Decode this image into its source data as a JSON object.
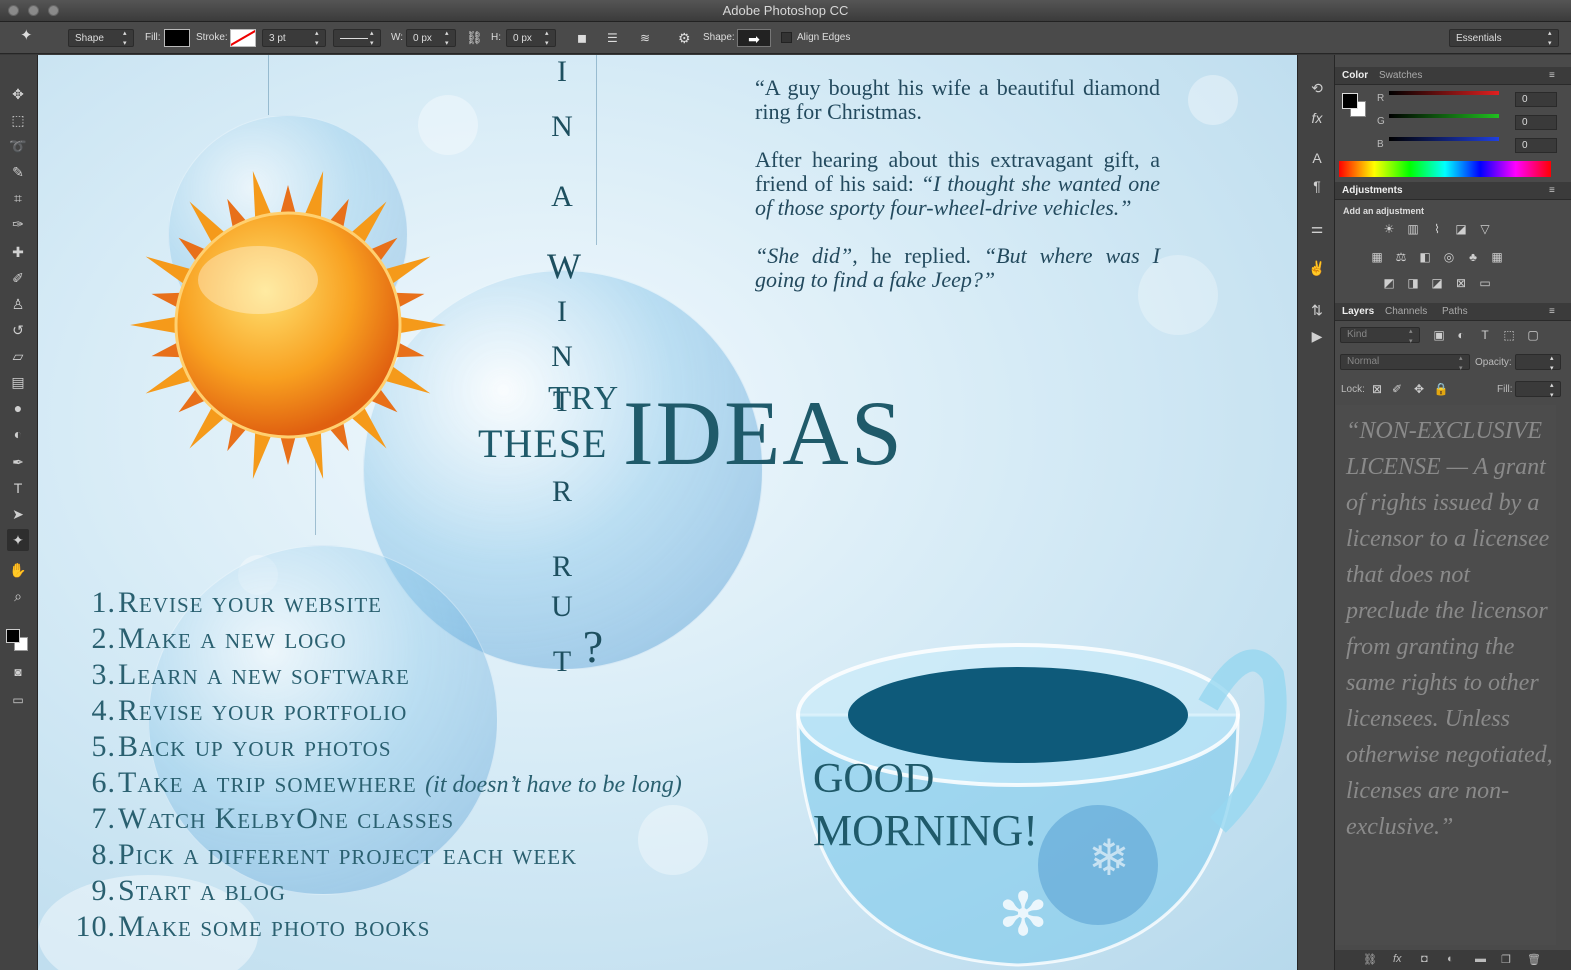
{
  "app": {
    "title": "Adobe Photoshop CC"
  },
  "options_bar": {
    "mode": "Shape",
    "fill_label": "Fill:",
    "stroke_label": "Stroke:",
    "stroke_size": "3 pt",
    "w_label": "W:",
    "w_value": "0 px",
    "h_label": "H:",
    "h_value": "0 px",
    "shape_label": "Shape:",
    "align_edges": "Align Edges",
    "workspace": "Essentials"
  },
  "color_panel": {
    "tabs": [
      "Color",
      "Swatches"
    ],
    "r_label": "R",
    "g_label": "G",
    "b_label": "B",
    "r": "0",
    "g": "0",
    "b": "0"
  },
  "adjustments_panel": {
    "title": "Adjustments",
    "subtitle": "Add an adjustment"
  },
  "layers_panel": {
    "tabs": [
      "Layers",
      "Channels",
      "Paths"
    ],
    "kind": "Kind",
    "blend_mode": "Normal",
    "opacity_label": "Opacity:",
    "lock_label": "Lock:",
    "fill_label": "Fill:"
  },
  "canvas": {
    "joke": {
      "p1": "“A guy bought his wife a beautiful diamond ring for Christmas.",
      "p2a": "After hearing about this extravagant gift, a friend of his said: ",
      "p2b": "“I thought she wanted one of those sporty four-wheel-drive vehicles.”",
      "p3a": "“She did”",
      "p3b": ", he replied. ",
      "p3c": "“But where was I going to find a fake Jeep?”"
    },
    "vertical_letters": [
      "I",
      "N",
      "A",
      "W",
      "I",
      "N",
      "T",
      "R",
      "R",
      "U",
      "T",
      "?"
    ],
    "try": "TRY",
    "these": "THESE",
    "ideas": "IDEAS",
    "good": "GOOD",
    "morning": "MORNING!",
    "ideas_list": [
      {
        "num": "1.",
        "text": "Revise your website",
        "aside": ""
      },
      {
        "num": "2.",
        "text": "Make a new logo",
        "aside": ""
      },
      {
        "num": "3.",
        "text": "Learn a new software",
        "aside": ""
      },
      {
        "num": "4.",
        "text": "Revise your portfolio",
        "aside": ""
      },
      {
        "num": "5.",
        "text": "Back up your photos",
        "aside": ""
      },
      {
        "num": "6.",
        "text": "Take a trip somewhere",
        "aside": "(it doesn’t have to be long)"
      },
      {
        "num": "7.",
        "text": "Watch KelbyOne classes",
        "aside": ""
      },
      {
        "num": "8.",
        "text": "Pick a different project each week",
        "aside": ""
      },
      {
        "num": "9.",
        "text": "Start a blog",
        "aside": ""
      },
      {
        "num": "10.",
        "text": "Make some photo books",
        "aside": ""
      }
    ]
  },
  "license_text": "“NON-EXCLUSIVE LICENSE — A grant of rights issued by a licensor to a licensee that does not preclude the licensor from granting the same rights to other licensees. Unless otherwise negotiated, licenses are non-exclusive.”",
  "colors": {
    "accent_text": "#2a6070",
    "red": "#e02020",
    "green": "#20c020",
    "blue": "#2040e0"
  }
}
